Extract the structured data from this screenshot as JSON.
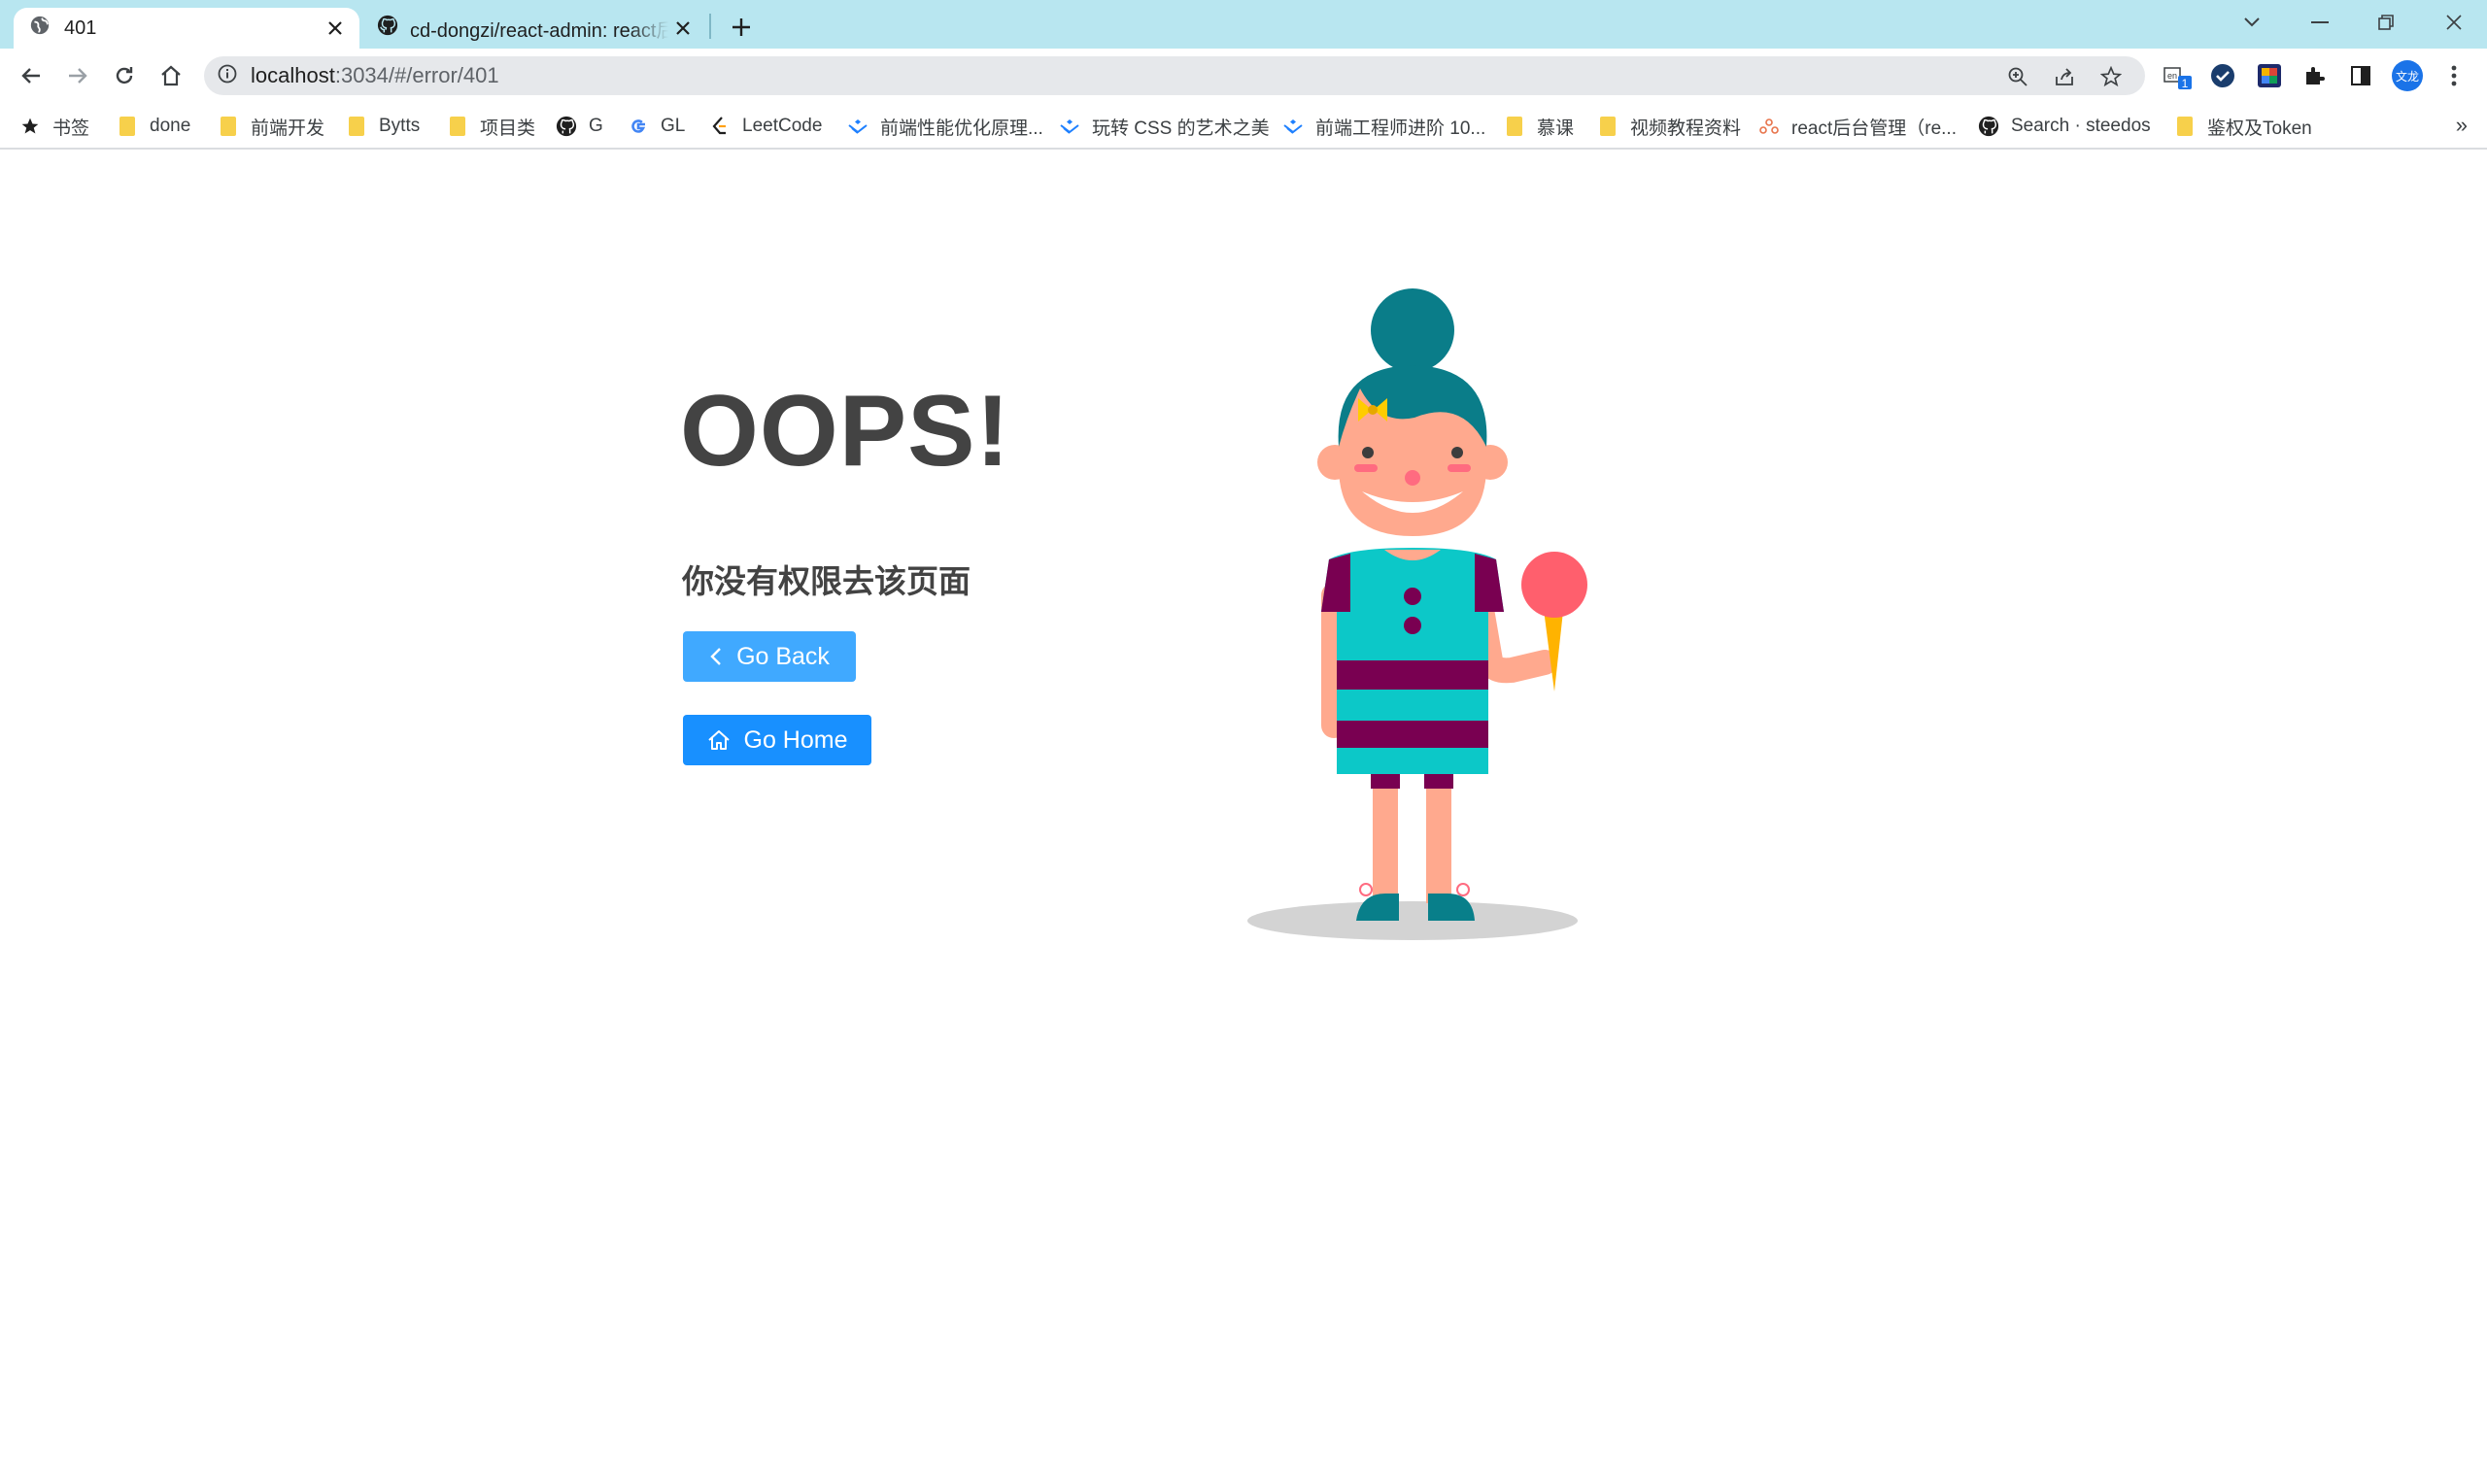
{
  "tabs": [
    {
      "title": "401",
      "icon": "globe-icon"
    },
    {
      "title": "cd-dongzi/react-admin: react后",
      "icon": "github-icon"
    }
  ],
  "address": {
    "host": "localhost",
    "path": ":3034/#/error/401"
  },
  "profile": {
    "label": "文龙"
  },
  "extension_badge": "1",
  "extension_badge_label": "en",
  "bookmarks": [
    {
      "label": "书签",
      "icon": "star-icon"
    },
    {
      "label": "done",
      "icon": "folder-icon"
    },
    {
      "label": "前端开发",
      "icon": "folder-icon"
    },
    {
      "label": "Bytts",
      "icon": "folder-icon"
    },
    {
      "label": "项目类",
      "icon": "folder-icon"
    },
    {
      "label": "G",
      "icon": "github-icon"
    },
    {
      "label": "GL",
      "icon": "google-icon"
    },
    {
      "label": "LeetCode",
      "icon": "leetcode-icon"
    },
    {
      "label": "前端性能优化原理...",
      "icon": "juejin-icon"
    },
    {
      "label": "玩转 CSS 的艺术之美",
      "icon": "juejin-icon"
    },
    {
      "label": "前端工程师进阶 10...",
      "icon": "juejin-icon"
    },
    {
      "label": "慕课",
      "icon": "folder-icon"
    },
    {
      "label": "视频教程资料",
      "icon": "folder-icon"
    },
    {
      "label": "react后台管理（re...",
      "icon": "site-icon"
    },
    {
      "label": "Search · steedos",
      "icon": "github-icon"
    },
    {
      "label": "鉴权及Token",
      "icon": "folder-icon"
    }
  ],
  "overflow_label": "»",
  "page": {
    "title": "OOPS!",
    "message": "你没有权限去该页面",
    "back_label": "Go Back",
    "home_label": "Go Home"
  },
  "colors": {
    "primary": "#1890ff",
    "primary_light": "#40a9ff",
    "tabstrip": "#b8e6f0",
    "text": "#434343"
  }
}
